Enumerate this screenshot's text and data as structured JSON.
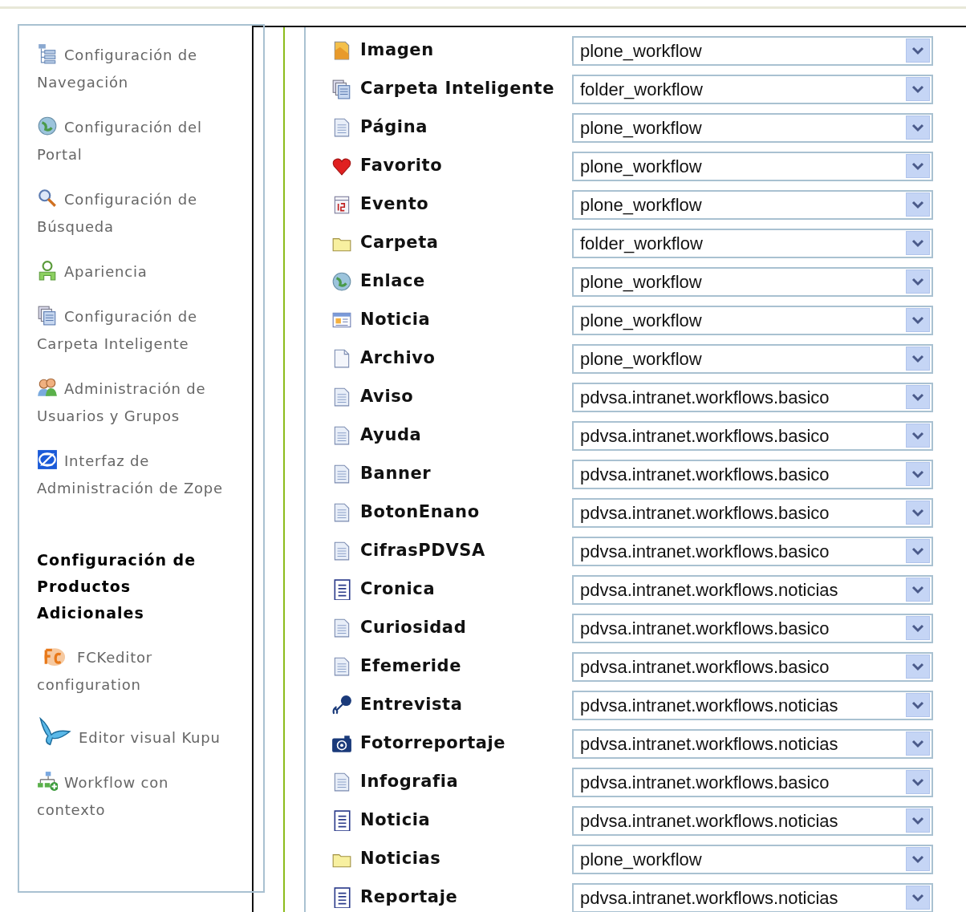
{
  "sidebar": {
    "items": [
      {
        "kind": "tree",
        "label": "Configuración de Navegación"
      },
      {
        "kind": "globe",
        "label": "Configuración del Portal"
      },
      {
        "kind": "search",
        "label": "Configuración de Búsqueda"
      },
      {
        "kind": "person",
        "label": "Apariencia"
      },
      {
        "kind": "stack",
        "label": "Configuración de Carpeta Inteligente"
      },
      {
        "kind": "users",
        "label": "Administración de Usuarios y Grupos"
      },
      {
        "kind": "zope",
        "label": "Interfaz de Administración de Zope"
      }
    ],
    "section_heading": "Configuración de Productos Adicionales",
    "addon_items": [
      {
        "kind": "blob",
        "label": "FCKeditor configuration"
      },
      {
        "kind": "butterfly",
        "label": "Editor visual Kupu"
      },
      {
        "kind": "flow",
        "label": "Workflow con contexto"
      }
    ]
  },
  "workflow_table": {
    "rows": [
      {
        "kind": "image",
        "type": "Imagen",
        "workflow": "plone_workflow"
      },
      {
        "kind": "stack",
        "type": "Carpeta Inteligente",
        "workflow": "folder_workflow"
      },
      {
        "kind": "page",
        "type": "Página",
        "workflow": "plone_workflow"
      },
      {
        "kind": "heart",
        "type": "Favorito",
        "workflow": "plone_workflow"
      },
      {
        "kind": "calendar",
        "type": "Evento",
        "workflow": "plone_workflow"
      },
      {
        "kind": "folder",
        "type": "Carpeta",
        "workflow": "folder_workflow"
      },
      {
        "kind": "globe",
        "type": "Enlace",
        "workflow": "plone_workflow"
      },
      {
        "kind": "news",
        "type": "Noticia",
        "workflow": "plone_workflow"
      },
      {
        "kind": "file",
        "type": "Archivo",
        "workflow": "plone_workflow"
      },
      {
        "kind": "page",
        "type": "Aviso",
        "workflow": "pdvsa.intranet.workflows.basico"
      },
      {
        "kind": "page",
        "type": "Ayuda",
        "workflow": "pdvsa.intranet.workflows.basico"
      },
      {
        "kind": "page",
        "type": "Banner",
        "workflow": "pdvsa.intranet.workflows.basico"
      },
      {
        "kind": "page",
        "type": "BotonEnano",
        "workflow": "pdvsa.intranet.workflows.basico"
      },
      {
        "kind": "page",
        "type": "CifrasPDVSA",
        "workflow": "pdvsa.intranet.workflows.basico"
      },
      {
        "kind": "lines",
        "type": "Cronica",
        "workflow": "pdvsa.intranet.workflows.noticias"
      },
      {
        "kind": "page",
        "type": "Curiosidad",
        "workflow": "pdvsa.intranet.workflows.basico"
      },
      {
        "kind": "page",
        "type": "Efemeride",
        "workflow": "pdvsa.intranet.workflows.basico"
      },
      {
        "kind": "mic",
        "type": "Entrevista",
        "workflow": "pdvsa.intranet.workflows.noticias"
      },
      {
        "kind": "camera",
        "type": "Fotorreportaje",
        "workflow": "pdvsa.intranet.workflows.noticias"
      },
      {
        "kind": "page",
        "type": "Infografia",
        "workflow": "pdvsa.intranet.workflows.basico"
      },
      {
        "kind": "lines",
        "type": "Noticia",
        "workflow": "pdvsa.intranet.workflows.noticias"
      },
      {
        "kind": "folder",
        "type": "Noticias",
        "workflow": "plone_workflow"
      },
      {
        "kind": "lines",
        "type": "Reportaje",
        "workflow": "pdvsa.intranet.workflows.noticias"
      }
    ]
  }
}
